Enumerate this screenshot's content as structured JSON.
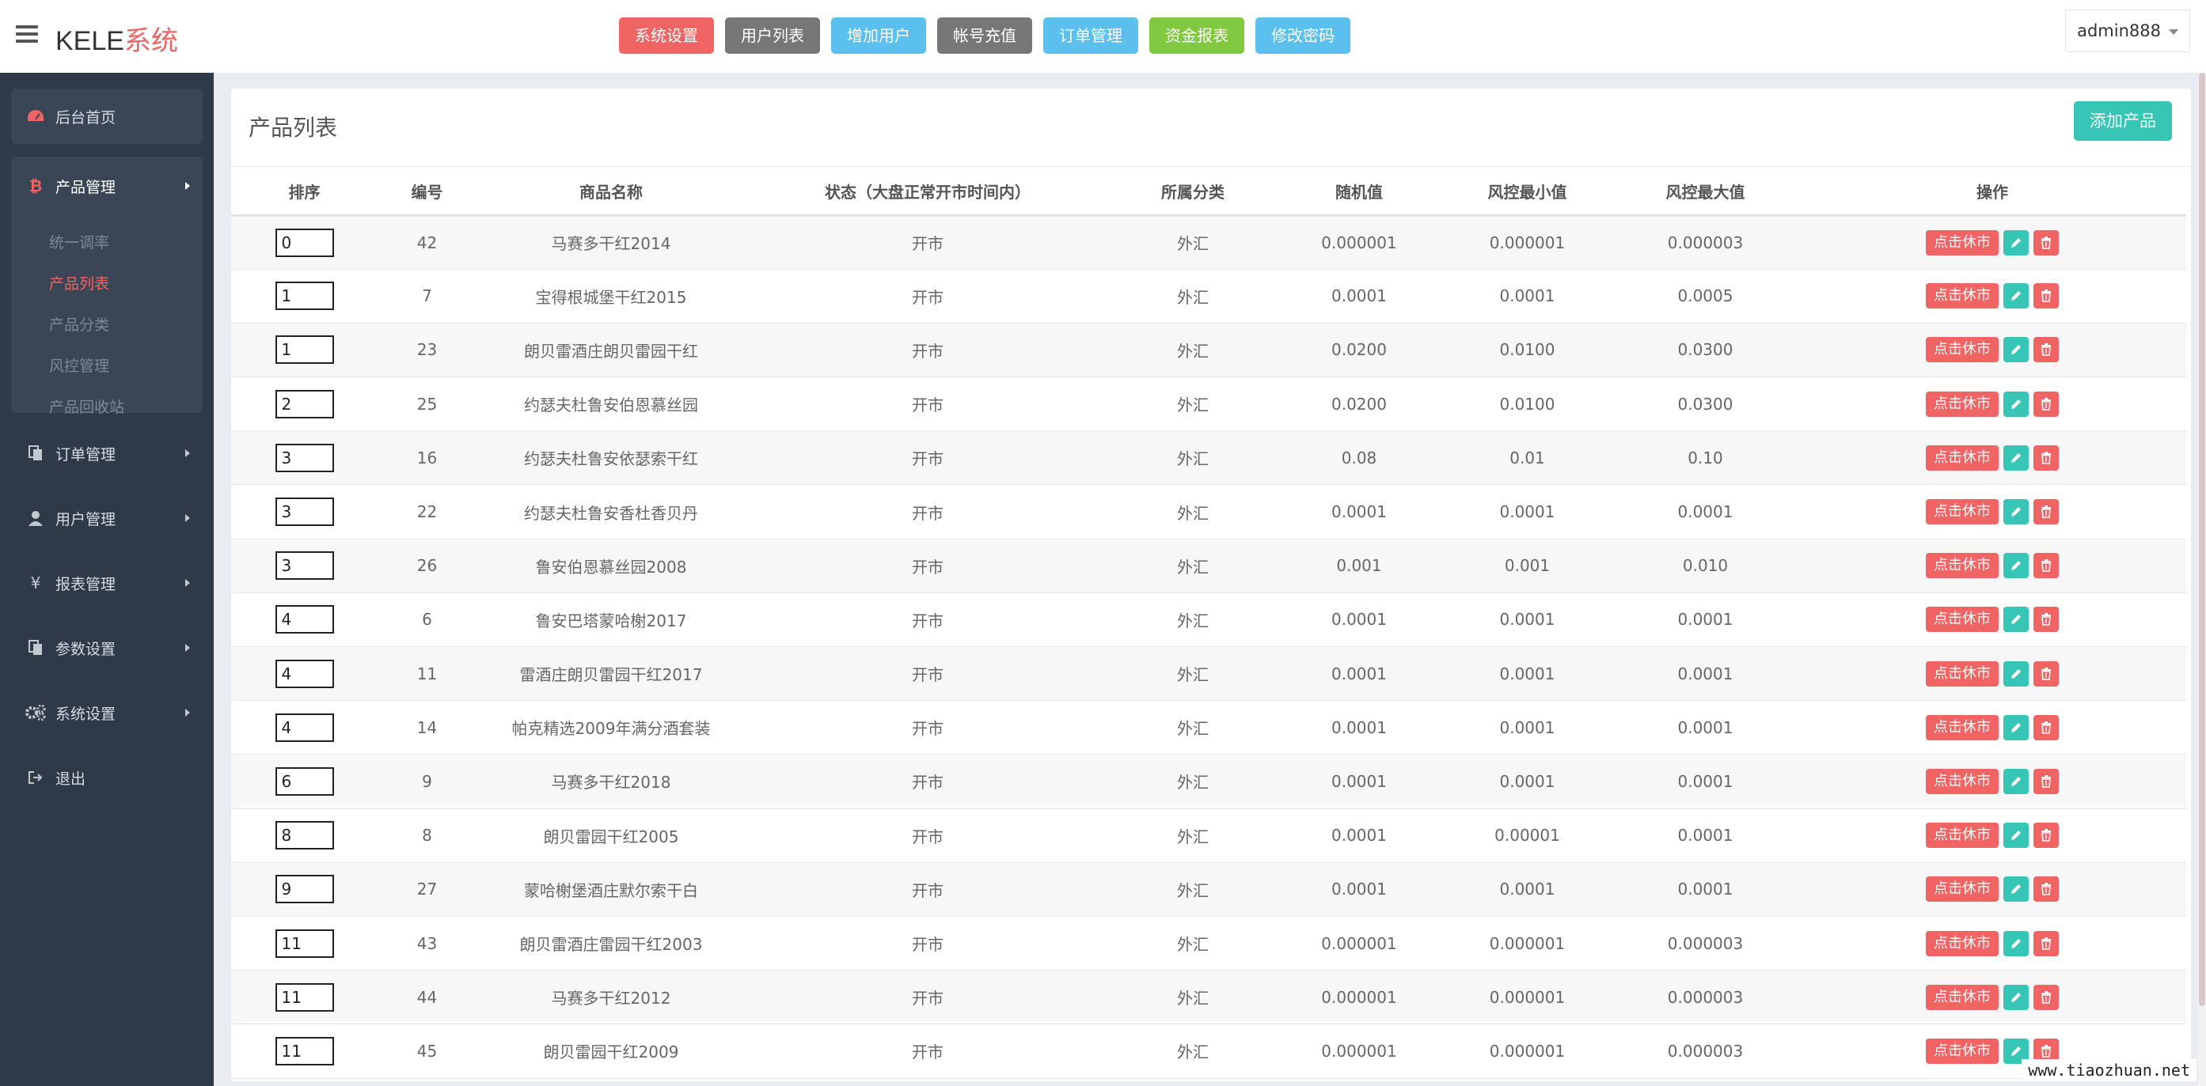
{
  "header": {
    "brand_main": "KELE",
    "brand_accent": "系统",
    "nav": [
      {
        "label": "系统设置",
        "color": "#f06464"
      },
      {
        "label": "用户列表",
        "color": "#777777"
      },
      {
        "label": "增加用户",
        "color": "#5bc0ee"
      },
      {
        "label": "帐号充值",
        "color": "#777777"
      },
      {
        "label": "订单管理",
        "color": "#5bc0ee"
      },
      {
        "label": "资金报表",
        "color": "#80c940"
      },
      {
        "label": "修改密码",
        "color": "#5bc0ee"
      }
    ],
    "user": "admin888"
  },
  "sidebar": {
    "home": "后台首页",
    "product_group": {
      "label": "产品管理",
      "items": [
        "统一调率",
        "产品列表",
        "产品分类",
        "风控管理",
        "产品回收站"
      ],
      "active": "产品列表"
    },
    "items": [
      "订单管理",
      "用户管理",
      "报表管理",
      "参数设置",
      "系统设置",
      "退出"
    ]
  },
  "main": {
    "title": "产品列表",
    "add_button": "添加产品",
    "columns": [
      "排序",
      "编号",
      "商品名称",
      "状态（大盘正常开市时间内）",
      "所属分类",
      "随机值",
      "风控最小值",
      "风控最大值",
      "操作"
    ],
    "op_rest_label": "点击休市",
    "rows": [
      {
        "sort": "0",
        "id": "42",
        "name": "马赛多干红2014",
        "status": "开市",
        "category": "外汇",
        "random": "0.000001",
        "min": "0.000001",
        "max": "0.000003"
      },
      {
        "sort": "1",
        "id": "7",
        "name": "宝得根城堡干红2015",
        "status": "开市",
        "category": "外汇",
        "random": "0.0001",
        "min": "0.0001",
        "max": "0.0005"
      },
      {
        "sort": "1",
        "id": "23",
        "name": "朗贝雷酒庄朗贝雷园干红",
        "status": "开市",
        "category": "外汇",
        "random": "0.0200",
        "min": "0.0100",
        "max": "0.0300"
      },
      {
        "sort": "2",
        "id": "25",
        "name": "约瑟夫杜鲁安伯恩慕丝园",
        "status": "开市",
        "category": "外汇",
        "random": "0.0200",
        "min": "0.0100",
        "max": "0.0300"
      },
      {
        "sort": "3",
        "id": "16",
        "name": "约瑟夫杜鲁安依瑟索干红",
        "status": "开市",
        "category": "外汇",
        "random": "0.08",
        "min": "0.01",
        "max": "0.10"
      },
      {
        "sort": "3",
        "id": "22",
        "name": "约瑟夫杜鲁安香杜香贝丹",
        "status": "开市",
        "category": "外汇",
        "random": "0.0001",
        "min": "0.0001",
        "max": "0.0001"
      },
      {
        "sort": "3",
        "id": "26",
        "name": "鲁安伯恩慕丝园2008",
        "status": "开市",
        "category": "外汇",
        "random": "0.001",
        "min": "0.001",
        "max": "0.010"
      },
      {
        "sort": "4",
        "id": "6",
        "name": "鲁安巴塔蒙哈榭2017",
        "status": "开市",
        "category": "外汇",
        "random": "0.0001",
        "min": "0.0001",
        "max": "0.0001"
      },
      {
        "sort": "4",
        "id": "11",
        "name": "雷酒庄朗贝雷园干红2017",
        "status": "开市",
        "category": "外汇",
        "random": "0.0001",
        "min": "0.0001",
        "max": "0.0001"
      },
      {
        "sort": "4",
        "id": "14",
        "name": "帕克精选2009年满分酒套装",
        "status": "开市",
        "category": "外汇",
        "random": "0.0001",
        "min": "0.0001",
        "max": "0.0001"
      },
      {
        "sort": "6",
        "id": "9",
        "name": "马赛多干红2018",
        "status": "开市",
        "category": "外汇",
        "random": "0.0001",
        "min": "0.0001",
        "max": "0.0001"
      },
      {
        "sort": "8",
        "id": "8",
        "name": "朗贝雷园干红2005",
        "status": "开市",
        "category": "外汇",
        "random": "0.0001",
        "min": "0.00001",
        "max": "0.0001"
      },
      {
        "sort": "9",
        "id": "27",
        "name": "蒙哈榭堡酒庄默尔索干白",
        "status": "开市",
        "category": "外汇",
        "random": "0.0001",
        "min": "0.0001",
        "max": "0.0001"
      },
      {
        "sort": "11",
        "id": "43",
        "name": "朗贝雷酒庄雷园干红2003",
        "status": "开市",
        "category": "外汇",
        "random": "0.000001",
        "min": "0.000001",
        "max": "0.000003"
      },
      {
        "sort": "11",
        "id": "44",
        "name": "马赛多干红2012",
        "status": "开市",
        "category": "外汇",
        "random": "0.000001",
        "min": "0.000001",
        "max": "0.000003"
      },
      {
        "sort": "11",
        "id": "45",
        "name": "朗贝雷园干红2009",
        "status": "开市",
        "category": "外汇",
        "random": "0.000001",
        "min": "0.000001",
        "max": "0.000003"
      }
    ]
  },
  "watermark": "www.tiaozhuan.net"
}
